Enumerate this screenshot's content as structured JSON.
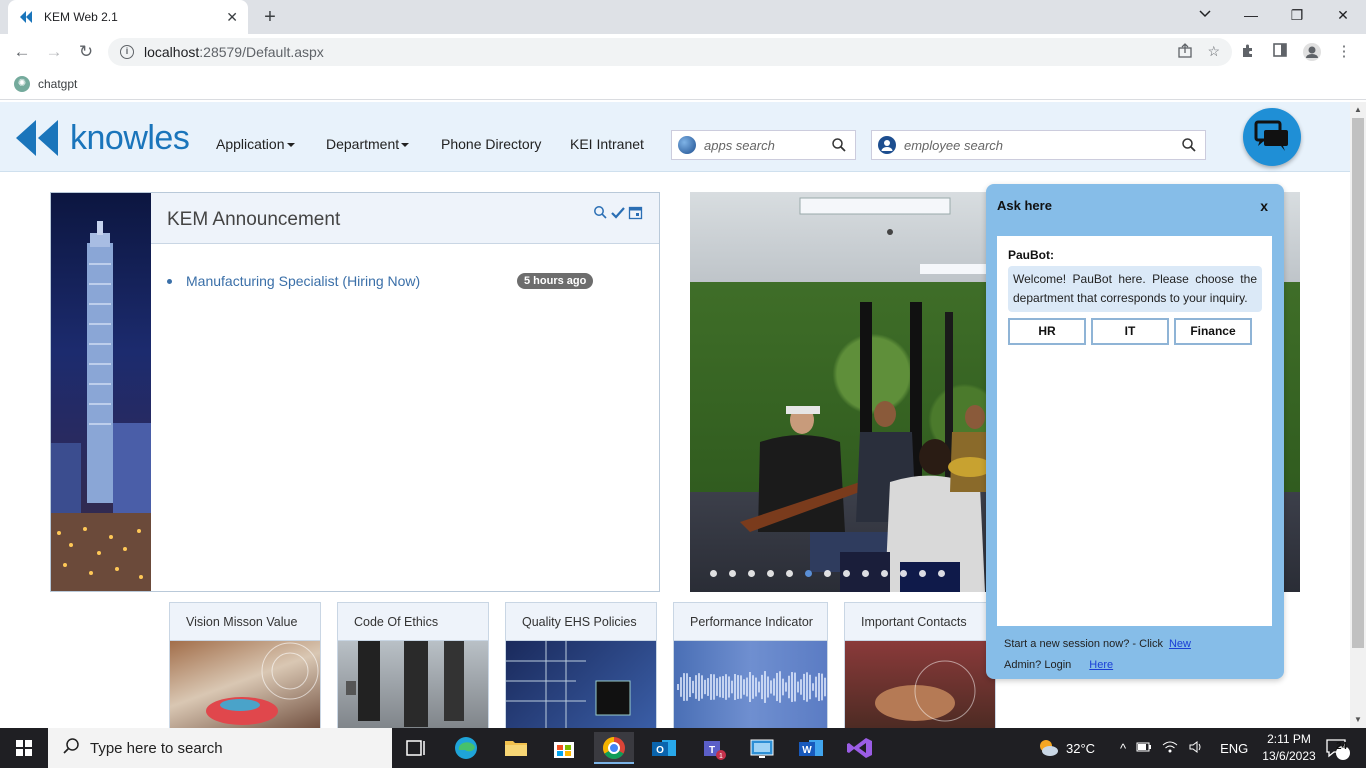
{
  "browser": {
    "tab_title": "KEM Web 2.1",
    "url_host": "localhost",
    "url_path": ":28579/Default.aspx",
    "bookmark": "chatgpt"
  },
  "header": {
    "logo_text": "knowles",
    "nav": [
      {
        "label": "Application",
        "dropdown": true
      },
      {
        "label": "Department",
        "dropdown": true
      },
      {
        "label": "Phone Directory",
        "dropdown": false
      },
      {
        "label": "KEI Intranet",
        "dropdown": false
      }
    ],
    "apps_search_placeholder": "apps search",
    "employee_search_placeholder": "employee search"
  },
  "announcement": {
    "title": "KEM Announcement",
    "items": [
      {
        "text": "Manufacturing Specialist (Hiring Now)",
        "age": "5 hours ago"
      }
    ]
  },
  "carousel": {
    "slide_count": 13,
    "active_index": 5
  },
  "cards": [
    {
      "title": "Vision Misson Value"
    },
    {
      "title": "Code Of Ethics"
    },
    {
      "title": "Quality EHS Policies"
    },
    {
      "title": "Performance Indicator"
    },
    {
      "title": "Important Contacts"
    }
  ],
  "chat": {
    "title": "Ask here",
    "close": "x",
    "bot_name": "PauBot:",
    "welcome": "Welcome! PauBot here. Please choose the department that corresponds to your inquiry.",
    "options": [
      "HR",
      "IT",
      "Finance"
    ],
    "new_session_text": "Start a new session now? - Click",
    "new_link": "New",
    "admin_text": "Admin? Login",
    "admin_link": "Here"
  },
  "taskbar": {
    "search_placeholder": "Type here to search",
    "weather": "32°C",
    "language": "ENG",
    "time": "2:11 PM",
    "date": "13/6/2023",
    "notifications": "24"
  },
  "colors": {
    "brand_blue": "#1a75bb",
    "header_bg": "#e8f2fb",
    "chat_bg": "#86bde8"
  }
}
